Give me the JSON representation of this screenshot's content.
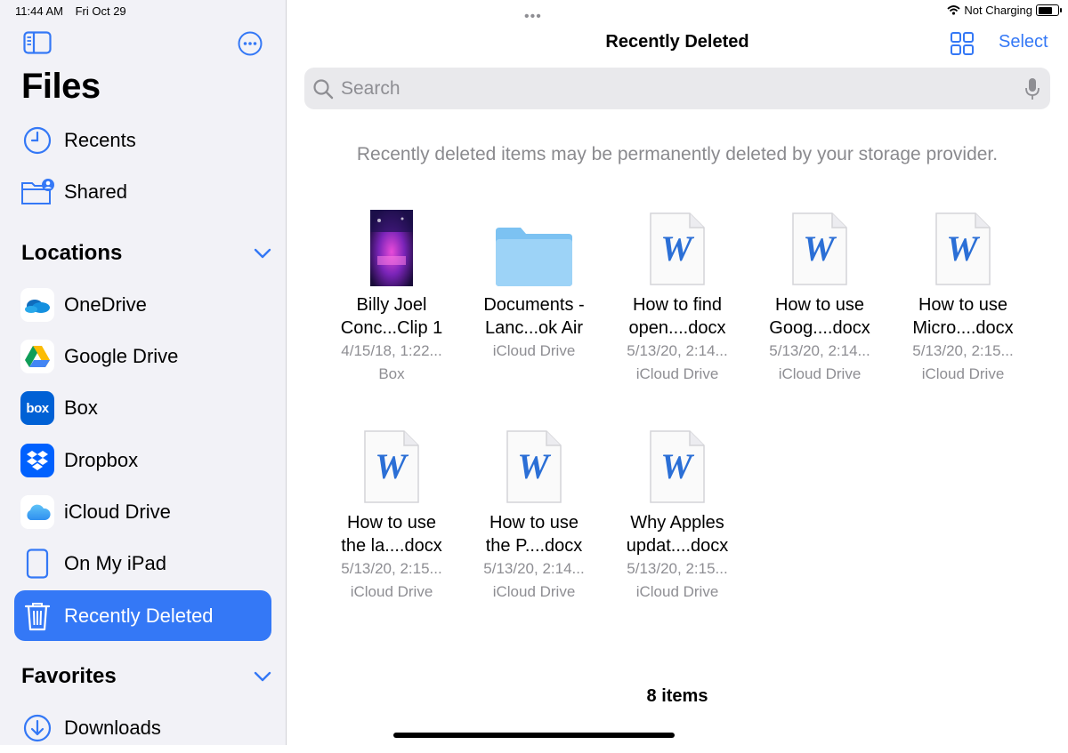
{
  "status": {
    "time": "11:44 AM",
    "date": "Fri Oct 29",
    "charging": "Not Charging"
  },
  "sidebar": {
    "title": "Files",
    "top_items": [
      {
        "label": "Recents",
        "icon": "clock-icon"
      },
      {
        "label": "Shared",
        "icon": "shared-folder-icon"
      }
    ],
    "locations_title": "Locations",
    "locations": [
      {
        "label": "OneDrive",
        "icon": "onedrive-icon"
      },
      {
        "label": "Google Drive",
        "icon": "google-drive-icon"
      },
      {
        "label": "Box",
        "icon": "box-icon",
        "icon_text": "box"
      },
      {
        "label": "Dropbox",
        "icon": "dropbox-icon"
      },
      {
        "label": "iCloud Drive",
        "icon": "icloud-icon"
      },
      {
        "label": "On My iPad",
        "icon": "ipad-icon"
      },
      {
        "label": "Recently Deleted",
        "icon": "trash-icon",
        "selected": true
      }
    ],
    "favorites_title": "Favorites",
    "favorites": [
      {
        "label": "Downloads",
        "icon": "download-icon"
      }
    ]
  },
  "main": {
    "title": "Recently Deleted",
    "select_label": "Select",
    "search_placeholder": "Search",
    "notice": "Recently deleted items may be permanently deleted by your storage provider.",
    "files": [
      {
        "name1": "Billy Joel",
        "name2": "Conc...Clip 1",
        "date": "4/15/18, 1:22...",
        "source": "Box",
        "kind": "video"
      },
      {
        "name1": "Documents -",
        "name2": "Lanc...ok Air",
        "date": "",
        "source": "iCloud Drive",
        "kind": "folder"
      },
      {
        "name1": "How to find",
        "name2": "open....docx",
        "date": "5/13/20, 2:14...",
        "source": "iCloud Drive",
        "kind": "word"
      },
      {
        "name1": "How to use",
        "name2": "Goog....docx",
        "date": "5/13/20, 2:14...",
        "source": "iCloud Drive",
        "kind": "word"
      },
      {
        "name1": "How to use",
        "name2": "Micro....docx",
        "date": "5/13/20, 2:15...",
        "source": "iCloud Drive",
        "kind": "word"
      },
      {
        "name1": "How to use",
        "name2": "the la....docx",
        "date": "5/13/20, 2:15...",
        "source": "iCloud Drive",
        "kind": "word"
      },
      {
        "name1": "How to use",
        "name2": "the P....docx",
        "date": "5/13/20, 2:14...",
        "source": "iCloud Drive",
        "kind": "word"
      },
      {
        "name1": "Why Apples",
        "name2": "updat....docx",
        "date": "5/13/20, 2:15...",
        "source": "iCloud Drive",
        "kind": "word"
      }
    ],
    "item_count": "8 items"
  },
  "colors": {
    "accent": "#3478f6",
    "sidebar_bg": "#f2f2f7",
    "secondary_text": "#8e8e93"
  }
}
